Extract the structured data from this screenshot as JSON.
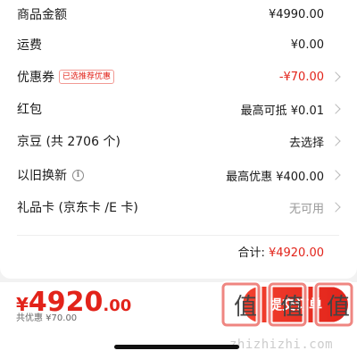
{
  "order": {
    "rows": [
      {
        "label": "商品金额",
        "value": "¥4990.00"
      },
      {
        "label": "运费",
        "value": "¥0.00"
      },
      {
        "label": "优惠券",
        "badge": "已选推荐优惠",
        "value": "-¥70.00"
      },
      {
        "label": "红包",
        "value": "最高可抵 ¥0.01"
      },
      {
        "label": "京豆 (共 2706 个)",
        "value": "去选择"
      },
      {
        "label": "以旧换新",
        "value": "最高优惠 ¥400.00"
      },
      {
        "label": "礼品卡 (京东卡 /E 卡)",
        "value": "无可用"
      }
    ],
    "total": {
      "label": "合计:",
      "amount": "¥4920.00"
    }
  },
  "footer": {
    "price_symbol": "¥",
    "price_int": "4920",
    "price_dec": ".00",
    "saved": "共优惠 ¥70.00",
    "submit_label": "提交订单"
  },
  "watermark": {
    "brand": "值",
    "url": "zhizhizhi.com"
  },
  "colors": {
    "accent": "#e2231a",
    "background": "#f2f2f2",
    "card": "#ffffff"
  }
}
